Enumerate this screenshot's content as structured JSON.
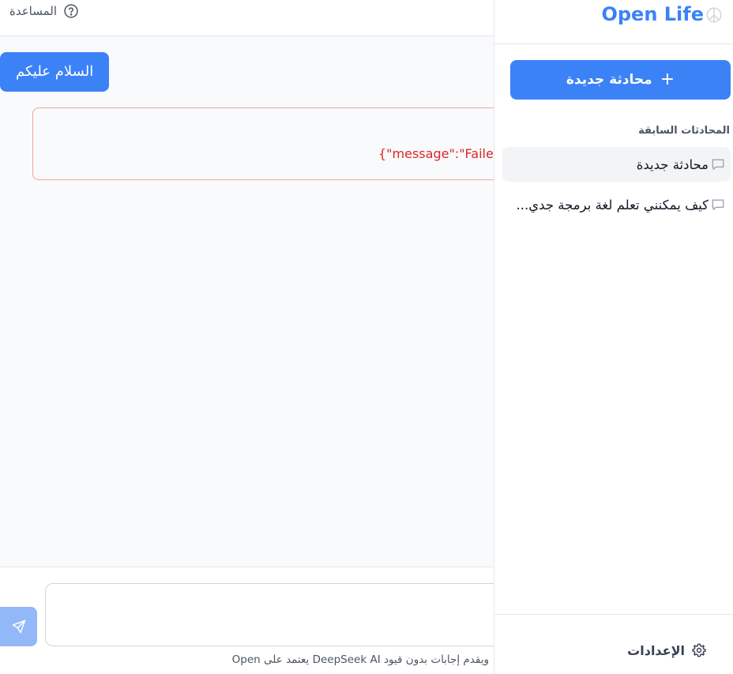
{
  "header": {
    "help_label": "المساعدة"
  },
  "chat": {
    "user_message": "السلام عليكم",
    "error_text": "{\"message\":\"Failed"
  },
  "composer": {
    "placeholder": "",
    "footer_note": "Open يعتمد على DeepSeek AI ويقدم إجابات بدون قيود"
  },
  "sidebar": {
    "brand": "Open Life",
    "new_chat_label": "محادثة جديدة",
    "section_title": "المحادثات السابقة",
    "conversations": [
      {
        "label": "محادثة جديدة",
        "active": true
      },
      {
        "label": "كيف يمكنني تعلم لغة برمجة جدي...",
        "active": false
      }
    ],
    "settings_label": "الإعدادات"
  },
  "colors": {
    "accent": "#3b82f6",
    "error": "#dc2626",
    "error_border": "#f4a3a3",
    "chat_bg": "#f9fafb"
  },
  "icons": [
    "help-icon",
    "send-icon",
    "plus-icon",
    "chat-bubble-icon",
    "gear-icon",
    "brand-icon"
  ]
}
